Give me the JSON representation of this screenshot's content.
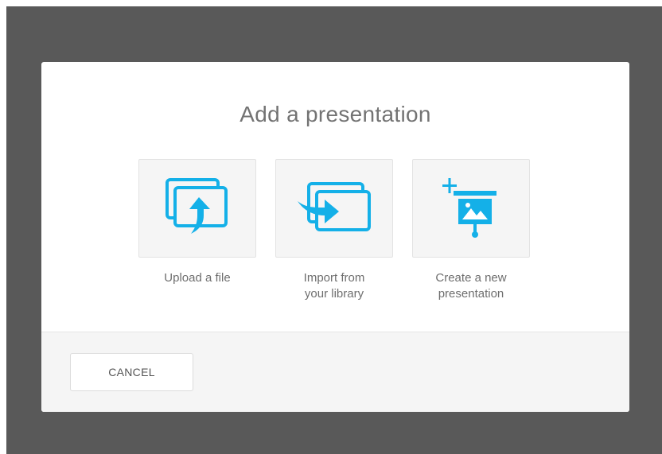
{
  "modal": {
    "title": "Add a presentation",
    "options": [
      {
        "icon": "upload-file-icon",
        "label_lines": [
          "Upload a file"
        ]
      },
      {
        "icon": "import-library-icon",
        "label_lines": [
          "Import from",
          "your library"
        ]
      },
      {
        "icon": "create-presentation-icon",
        "label_lines": [
          "Create a new",
          "presentation"
        ]
      }
    ],
    "cancel_label": "CANCEL"
  },
  "colors": {
    "overlay": "#595959",
    "accent": "#14b0e8",
    "tile_background": "#f5f5f5",
    "footer_background": "#f5f5f5",
    "text": "#737373"
  }
}
